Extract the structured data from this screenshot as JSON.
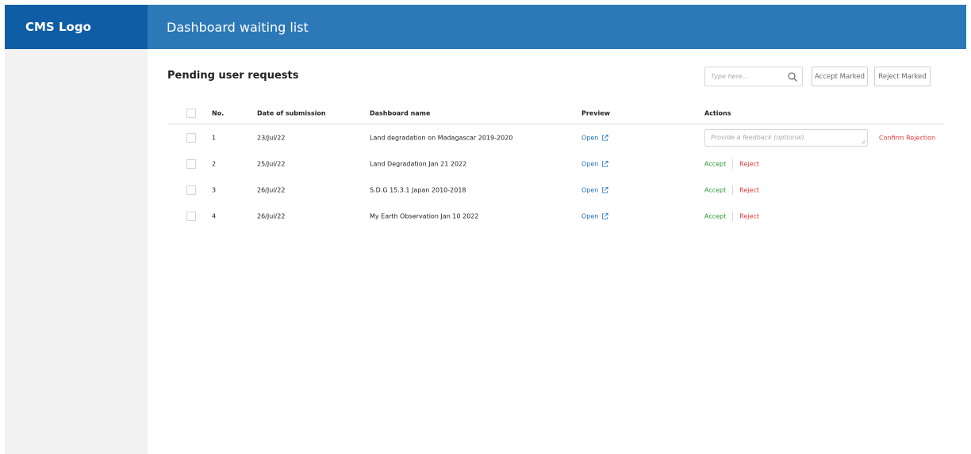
{
  "header": {
    "logo": "CMS Logo",
    "title": "Dashboard waiting list"
  },
  "main": {
    "section_title": "Pending user requests",
    "search": {
      "placeholder": "Type here...",
      "icon": "search-icon"
    },
    "accept_marked_label": "Accept Marked",
    "reject_marked_label": "Reject Marked"
  },
  "table": {
    "columns": [
      "No.",
      "Date of submission",
      "Dashboard name",
      "Preview",
      "Actions"
    ],
    "rows": [
      {
        "no": "1",
        "date": "23/Jul/22",
        "name": "Land degradation on Madagascar 2019-2020",
        "preview": "Open",
        "feedback_placeholder": "Provide a feedback (optional)",
        "confirm_label": "Confirm Rejection"
      },
      {
        "no": "2",
        "date": "25/Jul/22",
        "name": "Land Degradation Jan 21 2022",
        "preview": "Open",
        "accept_label": "Accept",
        "reject_label": "Reject"
      },
      {
        "no": "3",
        "date": "26/Jul/22",
        "name": "S.D.G 15.3.1 Japan 2010-2018",
        "preview": "Open",
        "accept_label": "Accept",
        "reject_label": "Reject"
      },
      {
        "no": "4",
        "date": "26/Jul/22",
        "name": "My Earth Observation Jan 10 2022",
        "preview": "Open",
        "accept_label": "Accept",
        "reject_label": "Reject"
      }
    ]
  },
  "colors": {
    "logo_bg": "#0f5ea5",
    "header_bg": "#2d79b8",
    "sidebar_bg": "#f2f2f2",
    "link": "#1f6fc0",
    "accept": "#2f9a3a",
    "reject": "#e23b3b"
  }
}
